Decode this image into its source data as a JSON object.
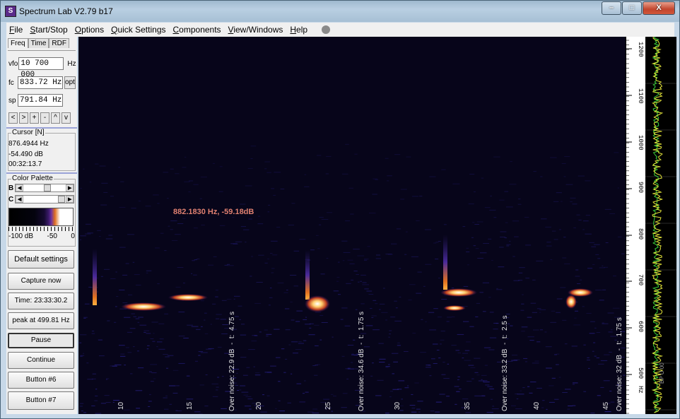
{
  "window": {
    "title": "Spectrum Lab V2.79 b17",
    "buttons": [
      "–",
      "□",
      "X"
    ]
  },
  "menu": [
    {
      "label": "File"
    },
    {
      "label": "Start/Stop"
    },
    {
      "label": "Options"
    },
    {
      "label": "Quick Settings"
    },
    {
      "label": "Components"
    },
    {
      "label": "View/Windows"
    },
    {
      "label": "Help"
    }
  ],
  "tabs": [
    "Freq",
    "Time",
    "RDF"
  ],
  "freq": {
    "vfo_label": "vfo",
    "vfo_value": "10 700 000",
    "vfo_unit": "Hz",
    "fc_label": "fc",
    "fc_value": "833.72 Hz",
    "fc_btn": "opt",
    "sp_label": "sp",
    "sp_value": "791.84 Hz",
    "nav_buttons": [
      "<",
      ">",
      "+",
      "-",
      "^",
      "v"
    ]
  },
  "cursor": {
    "title": "Cursor [N]",
    "freq": "876.4944 Hz",
    "level": "-54.490 dB",
    "time": "00:32:13.7"
  },
  "palette": {
    "title": "Color Palette",
    "b_label": "B",
    "c_label": "C",
    "scale": [
      "-100 dB",
      "-50",
      "0"
    ]
  },
  "buttons": {
    "default_settings": "Default settings",
    "capture_now": "Capture now",
    "time": "Time:  23:33:30.2",
    "peak": "peak at 499.81 Hz",
    "pause": "Pause",
    "continue": "Continue",
    "button6": "Button #6",
    "button7": "Button #7"
  },
  "spectrogram": {
    "peak_marker": "882.1830 Hz, -59.18dB",
    "time_ticks": [
      "10",
      "15",
      "20",
      "25",
      "30",
      "35",
      "40",
      "45"
    ],
    "annotations": [
      "Over noise: 22.9 dB  -  t:  4.75 s",
      "Over noise: 34.6 dB  -  t:  1.75 s",
      "Over noise: 33.2 dB  -  t:  2.5 s",
      "Over noise: 32 dB  -  t:  1.75 s"
    ]
  },
  "freq_axis": {
    "ticks": [
      "1200",
      "1100",
      "1000",
      "900",
      "800",
      "700",
      "600",
      "500"
    ],
    "unit": "Hz"
  },
  "trace_label": "BP U 00",
  "colors": {
    "background": "#07051a",
    "peak_label": "#e08070",
    "trace_green": "#3ad23a",
    "trace_yellow": "#e6e63a"
  }
}
